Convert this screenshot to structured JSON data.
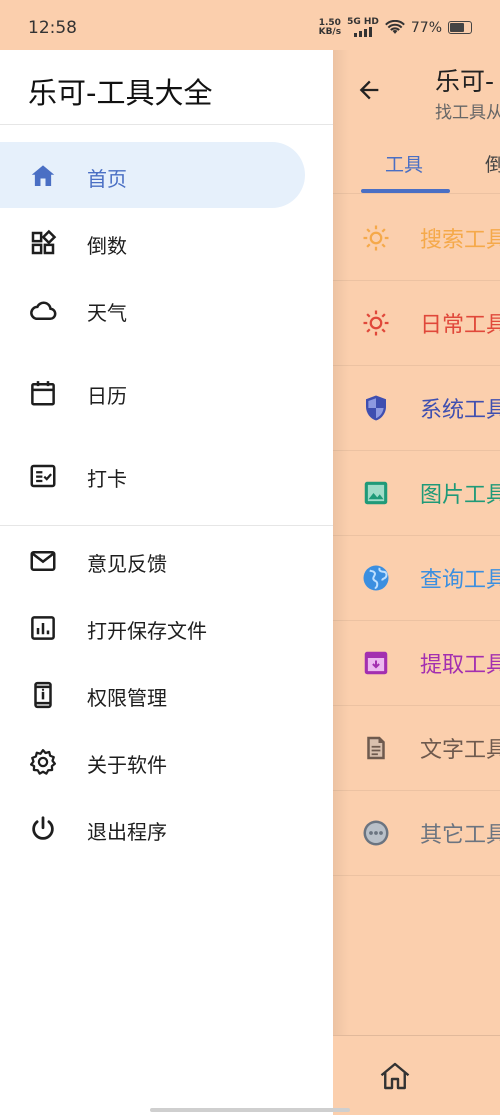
{
  "status_bar": {
    "time": "12:58",
    "net_speed_value": "1.50",
    "net_speed_unit": "KB/s",
    "signal_label": "5G HD",
    "battery_percent": "77%",
    "battery_level": 0.77
  },
  "drawer": {
    "title": "乐可-工具大全",
    "primary_items": [
      {
        "label": "首页",
        "icon": "home-icon",
        "active": true
      },
      {
        "label": "倒数",
        "icon": "widgets-icon"
      },
      {
        "label": "天气",
        "icon": "cloud-icon"
      },
      {
        "label": "日历",
        "icon": "calendar-icon"
      },
      {
        "label": "打卡",
        "icon": "checklist-icon"
      }
    ],
    "secondary_items": [
      {
        "label": "意见反馈",
        "icon": "mail-icon"
      },
      {
        "label": "打开保存文件",
        "icon": "chart-icon"
      },
      {
        "label": "权限管理",
        "icon": "phone-info-icon"
      },
      {
        "label": "关于软件",
        "icon": "gear-icon"
      },
      {
        "label": "退出程序",
        "icon": "power-icon"
      }
    ]
  },
  "main": {
    "title": "乐可-",
    "subtitle": "找工具从",
    "tabs": [
      {
        "label": "工具",
        "active": true
      },
      {
        "label": "倒"
      }
    ],
    "categories": [
      {
        "label": "搜索工具",
        "icon": "sun-icon",
        "color": "#f5a94a"
      },
      {
        "label": "日常工具",
        "icon": "sun-icon",
        "color": "#e0483a"
      },
      {
        "label": "系统工具",
        "icon": "shield-icon",
        "color": "#3f4fb0"
      },
      {
        "label": "图片工具",
        "icon": "image-icon",
        "color": "#1f9a78"
      },
      {
        "label": "查询工具",
        "icon": "globe-icon",
        "color": "#3b8fe0"
      },
      {
        "label": "提取工具",
        "icon": "archive-icon",
        "color": "#a32fb0"
      },
      {
        "label": "文字工具",
        "icon": "document-icon",
        "color": "#6e5a4e"
      },
      {
        "label": "其它工具",
        "icon": "more-icon",
        "color": "#6b7480"
      }
    ]
  },
  "bottom_nav": {
    "icon": "home-icon"
  }
}
